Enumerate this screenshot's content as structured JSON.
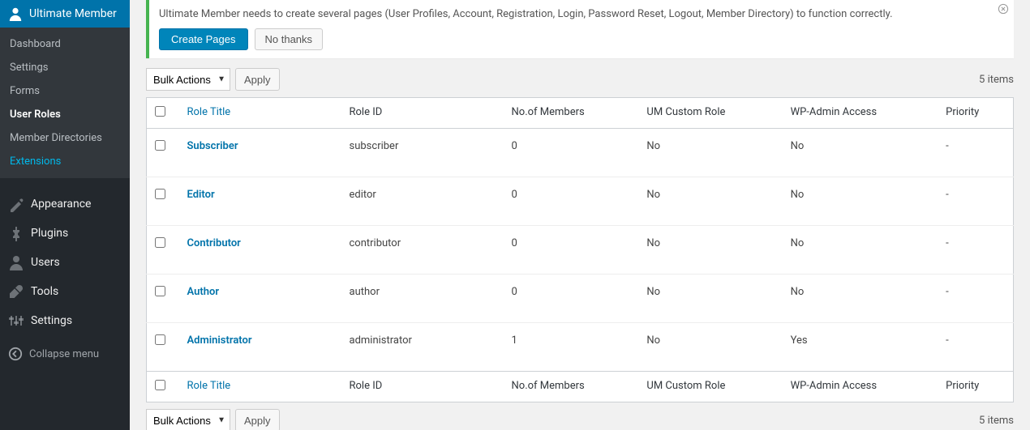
{
  "sidebar": {
    "plugin_title": "Ultimate Member",
    "submenu": [
      {
        "label": "Dashboard",
        "active": false,
        "highlight": false
      },
      {
        "label": "Settings",
        "active": false,
        "highlight": false
      },
      {
        "label": "Forms",
        "active": false,
        "highlight": false
      },
      {
        "label": "User Roles",
        "active": true,
        "highlight": false
      },
      {
        "label": "Member Directories",
        "active": false,
        "highlight": false
      },
      {
        "label": "Extensions",
        "active": false,
        "highlight": true
      }
    ],
    "main_items": [
      {
        "label": "Appearance",
        "icon": "appearance"
      },
      {
        "label": "Plugins",
        "icon": "plugins"
      },
      {
        "label": "Users",
        "icon": "users"
      },
      {
        "label": "Tools",
        "icon": "tools"
      },
      {
        "label": "Settings",
        "icon": "settings"
      }
    ],
    "collapse": "Collapse menu"
  },
  "notice": {
    "text": "Ultimate Member needs to create several pages (User Profiles, Account, Registration, Login, Password Reset, Logout, Member Directory) to function correctly.",
    "create": "Create Pages",
    "no_thanks": "No thanks"
  },
  "bulk": {
    "label": "Bulk Actions",
    "apply": "Apply"
  },
  "items_count": "5 items",
  "columns": {
    "role_title": "Role Title",
    "role_id": "Role ID",
    "members": "No.of Members",
    "custom": "UM Custom Role",
    "admin": "WP-Admin Access",
    "priority": "Priority"
  },
  "rows": [
    {
      "title": "Subscriber",
      "id": "subscriber",
      "members": "0",
      "custom": "No",
      "admin": "No",
      "priority": "-"
    },
    {
      "title": "Editor",
      "id": "editor",
      "members": "0",
      "custom": "No",
      "admin": "No",
      "priority": "-"
    },
    {
      "title": "Contributor",
      "id": "contributor",
      "members": "0",
      "custom": "No",
      "admin": "No",
      "priority": "-"
    },
    {
      "title": "Author",
      "id": "author",
      "members": "0",
      "custom": "No",
      "admin": "No",
      "priority": "-"
    },
    {
      "title": "Administrator",
      "id": "administrator",
      "members": "1",
      "custom": "No",
      "admin": "Yes",
      "priority": "-"
    }
  ]
}
